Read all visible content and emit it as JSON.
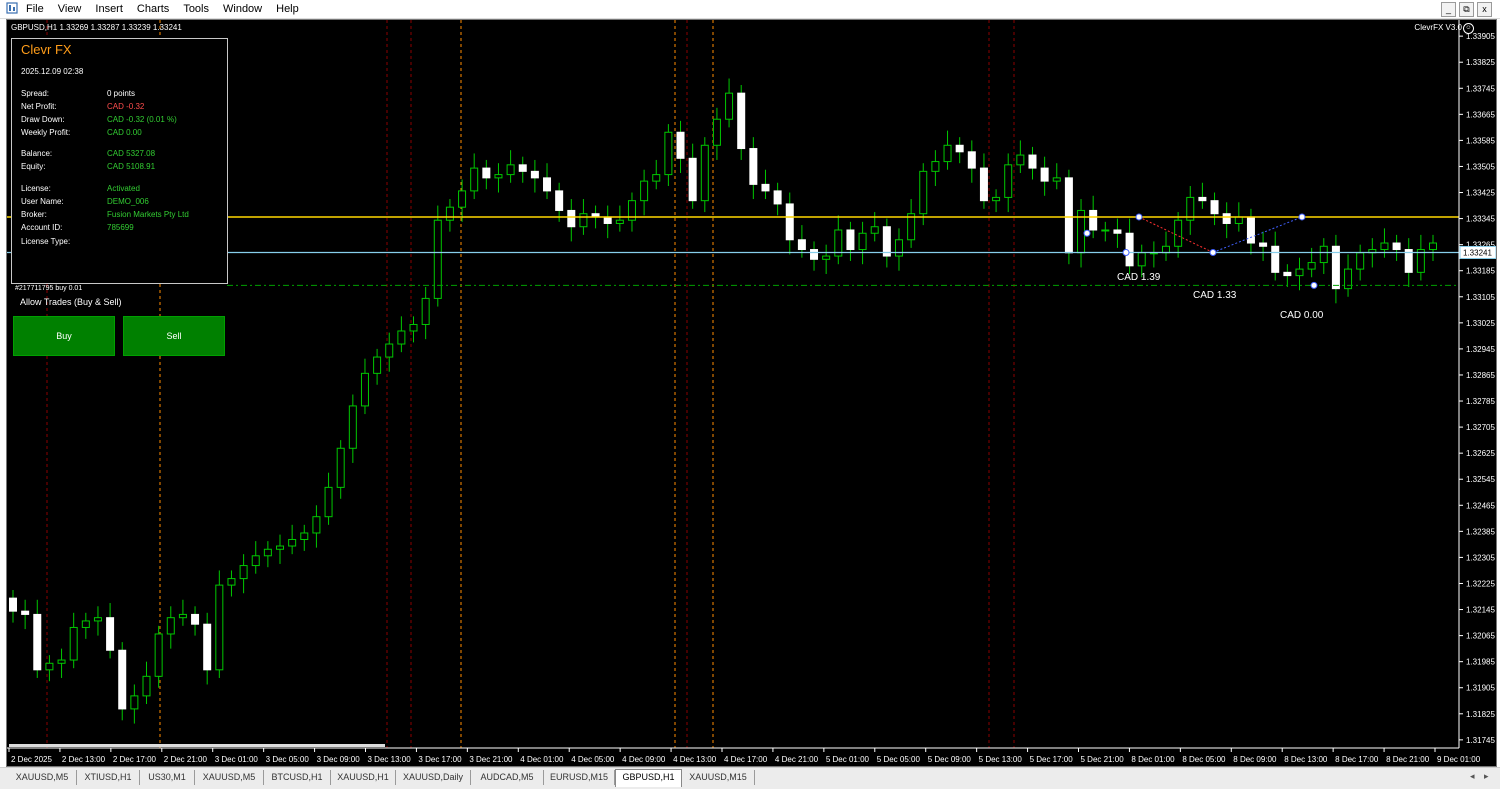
{
  "menu": {
    "app_icon": "metatrader-icon",
    "items": [
      "File",
      "View",
      "Insert",
      "Charts",
      "Tools",
      "Window",
      "Help"
    ],
    "window_buttons": [
      "_",
      "⧉",
      "x"
    ]
  },
  "chart": {
    "symbol_line": "GBPUSD,H1  1.33269 1.33287 1.33239 1.33241",
    "ea_brand": "ClevrFX V3.0",
    "current_price": "1.33241",
    "price_ticks": [
      "1.33905",
      "1.33825",
      "1.33745",
      "1.33665",
      "1.33585",
      "1.33505",
      "1.33425",
      "1.33345",
      "1.33265",
      "1.33185",
      "1.33105",
      "1.33025",
      "1.32945",
      "1.32865",
      "1.32785",
      "1.32705",
      "1.32625",
      "1.32545",
      "1.32465",
      "1.32385",
      "1.32305",
      "1.32225",
      "1.32145",
      "1.32065",
      "1.31985",
      "1.31905",
      "1.31825",
      "1.31745"
    ],
    "time_ticks": [
      "2 Dec 2025",
      "2 Dec 13:00",
      "2 Dec 17:00",
      "2 Dec 21:00",
      "3 Dec 01:00",
      "3 Dec 05:00",
      "3 Dec 09:00",
      "3 Dec 13:00",
      "3 Dec 17:00",
      "3 Dec 21:00",
      "4 Dec 01:00",
      "4 Dec 05:00",
      "4 Dec 09:00",
      "4 Dec 13:00",
      "4 Dec 17:00",
      "4 Dec 21:00",
      "5 Dec 01:00",
      "5 Dec 05:00",
      "5 Dec 09:00",
      "5 Dec 13:00",
      "5 Dec 17:00",
      "5 Dec 21:00",
      "8 Dec 01:00",
      "8 Dec 05:00",
      "8 Dec 09:00",
      "8 Dec 13:00",
      "8 Dec 17:00",
      "8 Dec 21:00",
      "9 Dec 01:00"
    ],
    "trade_labels": [
      "CAD 1.39",
      "CAD 1.33",
      "CAD 0.00"
    ],
    "colors": {
      "background": "#000000",
      "bull": "#00c800",
      "bear": "#ffffff",
      "grid": "#333333",
      "yellow_line": "#ffd700",
      "bid_line": "#87ceeb",
      "tp_line": "#00a000",
      "session_red": "#8b0000",
      "session_orange": "#ff8c00"
    }
  },
  "chart_data": {
    "type": "candlestick",
    "symbol": "GBPUSD",
    "timeframe": "H1",
    "ylim": [
      1.3172,
      1.3393
    ],
    "yellow_level": 1.3335,
    "bid_level": 1.33241,
    "dashed_level": 1.3314,
    "open": [
      1.3218,
      1.3214,
      1.3213,
      1.3196,
      1.3198,
      1.3199,
      1.3209,
      1.3211,
      1.3212,
      1.3202,
      1.3184,
      1.3188,
      1.3194,
      1.3207,
      1.3212,
      1.3213,
      1.321,
      1.3196,
      1.3222,
      1.3224,
      1.3228,
      1.3231,
      1.3233,
      1.3234,
      1.3236,
      1.3238,
      1.3243,
      1.3252,
      1.3264,
      1.3277,
      1.3287,
      1.3292,
      1.3296,
      1.33,
      1.3302,
      1.331,
      1.3334,
      1.3338,
      1.3343,
      1.335,
      1.3347,
      1.3348,
      1.3351,
      1.3349,
      1.3347,
      1.3343,
      1.3337,
      1.3332,
      1.3336,
      1.3335,
      1.3333,
      1.3334,
      1.334,
      1.3346,
      1.3348,
      1.3361,
      1.3353,
      1.334,
      1.3357,
      1.3365,
      1.3373,
      1.3356,
      1.3345,
      1.3343,
      1.3339,
      1.3328,
      1.3325,
      1.3322,
      1.3323,
      1.3331,
      1.3325,
      1.333,
      1.3332,
      1.3323,
      1.3328,
      1.3336,
      1.3349,
      1.3352,
      1.3357,
      1.3355,
      1.335,
      1.334,
      1.3341,
      1.3351,
      1.3354,
      1.335,
      1.3346,
      1.3347,
      1.3324,
      1.3337,
      1.3331,
      1.3331,
      1.333,
      1.332,
      1.3324,
      1.3324,
      1.3326,
      1.3334,
      1.3341,
      1.334,
      1.3336,
      1.3333,
      1.3335,
      1.3327,
      1.3326,
      1.3318,
      1.3317,
      1.3319,
      1.3321,
      1.3326,
      1.3313,
      1.3319,
      1.3324,
      1.3325,
      1.3327,
      1.3325,
      1.3318,
      1.3325
    ],
    "close": [
      1.3214,
      1.3213,
      1.3196,
      1.3198,
      1.3199,
      1.3209,
      1.3211,
      1.3212,
      1.3202,
      1.3184,
      1.3188,
      1.3194,
      1.3207,
      1.3212,
      1.3213,
      1.321,
      1.3196,
      1.3222,
      1.3224,
      1.3228,
      1.3231,
      1.3233,
      1.3234,
      1.3236,
      1.3238,
      1.3243,
      1.3252,
      1.3264,
      1.3277,
      1.3287,
      1.3292,
      1.3296,
      1.33,
      1.3302,
      1.331,
      1.3334,
      1.3338,
      1.3343,
      1.335,
      1.3347,
      1.3348,
      1.3351,
      1.3349,
      1.3347,
      1.3343,
      1.3337,
      1.3332,
      1.3336,
      1.3335,
      1.3333,
      1.3334,
      1.334,
      1.3346,
      1.3348,
      1.3361,
      1.3353,
      1.334,
      1.3357,
      1.3365,
      1.3373,
      1.3356,
      1.3345,
      1.3343,
      1.3339,
      1.3328,
      1.3325,
      1.3322,
      1.3323,
      1.3331,
      1.3325,
      1.333,
      1.3332,
      1.3323,
      1.3328,
      1.3336,
      1.3349,
      1.3352,
      1.3357,
      1.3355,
      1.335,
      1.334,
      1.3341,
      1.3351,
      1.3354,
      1.335,
      1.3346,
      1.3347,
      1.3324,
      1.3337,
      1.3331,
      1.3331,
      1.333,
      1.332,
      1.3324,
      1.3324,
      1.3326,
      1.3334,
      1.3341,
      1.334,
      1.3336,
      1.3333,
      1.3335,
      1.3327,
      1.3326,
      1.3318,
      1.3317,
      1.3319,
      1.3321,
      1.3326,
      1.3313,
      1.3319,
      1.3324,
      1.3325,
      1.3327,
      1.3325,
      1.3318,
      1.3325,
      1.3327
    ]
  },
  "panel": {
    "title": "Clevr FX",
    "datetime": "2025.12.09 02:38",
    "rows": [
      {
        "label": "Spread:",
        "value": "0 points",
        "color": "#ffffff"
      },
      {
        "label": "Net Profit:",
        "value": "CAD -0.32",
        "color": "#ff4d4d"
      },
      {
        "label": "Draw Down:",
        "value": "CAD -0.32 (0.01 %)",
        "color": "#32cd32"
      },
      {
        "label": "Weekly Profit:",
        "value": "CAD 0.00",
        "color": "#32cd32"
      },
      {
        "label": "Balance:",
        "value": "CAD 5327.08",
        "color": "#32cd32"
      },
      {
        "label": "Equity:",
        "value": "CAD 5108.91",
        "color": "#32cd32"
      },
      {
        "label": "License:",
        "value": "Activated",
        "color": "#32cd32"
      },
      {
        "label": "User Name:",
        "value": "DEMO_006",
        "color": "#32cd32"
      },
      {
        "label": "Broker:",
        "value": "Fusion Markets Pty Ltd",
        "color": "#32cd32"
      },
      {
        "label": "Account ID:",
        "value": "785699",
        "color": "#32cd32"
      },
      {
        "label": "License Type:",
        "value": "",
        "color": "#32cd32"
      }
    ],
    "order_line": "#217711795 buy 0.01",
    "allow_trades": "Allow Trades (Buy & Sell)",
    "buy_label": "Buy",
    "sell_label": "Sell"
  },
  "tabs": {
    "items": [
      "XAUUSD,M5",
      "XTIUSD,H1",
      "US30,M1",
      "XAUUSD,M5",
      "BTCUSD,H1",
      "XAUUSD,H1",
      "XAUUSD,Daily",
      "AUDCAD,M5",
      "EURUSD,M15",
      "GBPUSD,H1",
      "XAUUSD,M15"
    ],
    "active_index": 9,
    "prev": "◂",
    "next": "▸"
  }
}
